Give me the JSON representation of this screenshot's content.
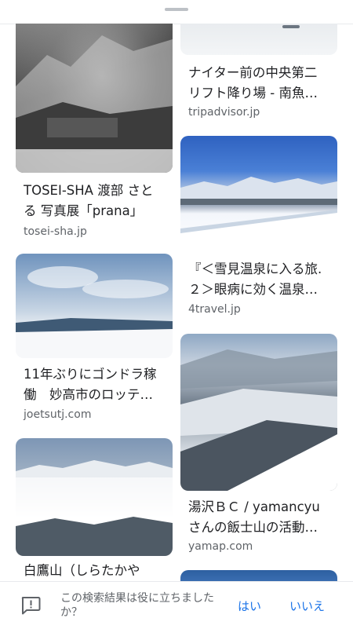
{
  "results": [
    {
      "title": "TOSEI-SHA 渡部 さとる 写真展「prana」",
      "domain": "tosei-sha.jp"
    },
    {
      "title": "11年ぶりにゴンドラ稼働　妙高市のロッテ…",
      "domain": "joetsutj.com"
    },
    {
      "title": "白鷹山（しらたかや",
      "domain": ""
    },
    {
      "title": "ナイター前の中央第二リフト降り場 - 南魚…",
      "domain": "tripadvisor.jp"
    },
    {
      "title": "『＜雪見温泉に入る旅.２＞眼病に効く温泉…",
      "domain": "4travel.jp"
    },
    {
      "title": "湯沢ＢＣ / yamancyu さんの飯士山の活動…",
      "domain": "yamap.com"
    }
  ],
  "feedback": {
    "question": "この検索結果は役に立ちましたか？",
    "yes": "はい",
    "no": "いいえ",
    "icon": "feedback-icon"
  },
  "colors": {
    "link": "#1a73e8",
    "secondary_text": "#5f6368",
    "primary_text": "#202124"
  }
}
